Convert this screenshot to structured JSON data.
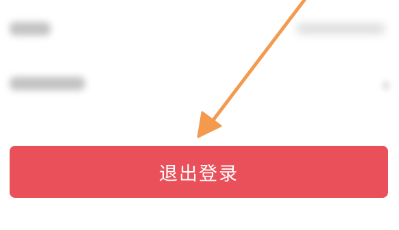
{
  "logout_button": {
    "label": "退出登录"
  },
  "colors": {
    "logout_button_bg": "#e9505a",
    "logout_label": "#ffffff",
    "annotation_arrow": "#f39a4f",
    "background": "#ffffff"
  },
  "icons": {
    "row_chevron": "chevron-right-icon",
    "annotation": "arrow-icon"
  }
}
